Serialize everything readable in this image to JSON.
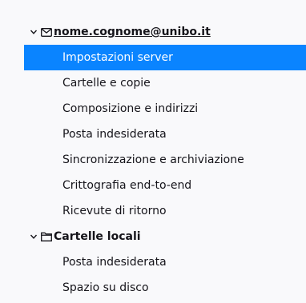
{
  "accounts": [
    {
      "name": "nome.cognome@unibo.it",
      "icon": "envelope-icon",
      "expanded": true,
      "items": [
        {
          "label": "Impostazioni server",
          "selected": true
        },
        {
          "label": "Cartelle e copie",
          "selected": false
        },
        {
          "label": "Composizione e indirizzi",
          "selected": false
        },
        {
          "label": "Posta indesiderata",
          "selected": false
        },
        {
          "label": "Sincronizzazione e archiviazione",
          "selected": false
        },
        {
          "label": "Crittografia end-to-end",
          "selected": false
        },
        {
          "label": "Ricevute di ritorno",
          "selected": false
        }
      ]
    },
    {
      "name": "Cartelle locali",
      "icon": "folder-icon",
      "expanded": true,
      "items": [
        {
          "label": "Posta indesiderata",
          "selected": false
        },
        {
          "label": "Spazio su disco",
          "selected": false
        }
      ]
    }
  ],
  "colors": {
    "selection": "#0a84ff",
    "background": "#f9f9fb",
    "text": "#15141a"
  }
}
